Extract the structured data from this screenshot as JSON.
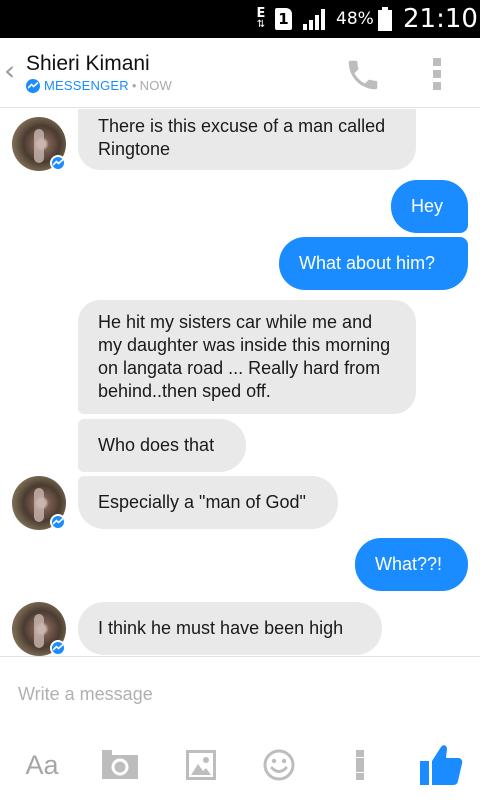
{
  "status_bar": {
    "network_letter": "E",
    "network_arrows": "⇅",
    "sim_label": "1",
    "battery_percent": "48%",
    "time": "21:10"
  },
  "header": {
    "contact_name": "Shieri Kimani",
    "app_name": "MESSENGER",
    "separator": "•",
    "last_active": "NOW",
    "back_glyph": "‹",
    "icons": [
      "back-icon",
      "phone-icon",
      "more-vertical-icon"
    ]
  },
  "messages": [
    {
      "from": "them",
      "text": "There is this excuse of a man called Ringtone"
    },
    {
      "from": "me",
      "text": "Hey"
    },
    {
      "from": "me",
      "text": "What about him?"
    },
    {
      "from": "them",
      "text": "He hit my sisters car while me and my daughter was inside this morning on langata road ... Really hard from behind..then sped off."
    },
    {
      "from": "them",
      "text": "Who does that"
    },
    {
      "from": "them",
      "text": "Especially a \"man of God\""
    },
    {
      "from": "me",
      "text": "What??!"
    },
    {
      "from": "them",
      "text": "I think he must have been high"
    }
  ],
  "composer": {
    "placeholder": "Write a message",
    "value": "",
    "text_format_label": "Aa",
    "icons": [
      "text-format-icon",
      "camera-icon",
      "gallery-icon",
      "emoji-icon",
      "more-vertical-icon",
      "thumbs-up-icon"
    ]
  },
  "colors": {
    "accent": "#1a8cff",
    "incoming_bubble": "#e9e9e9",
    "status_bar": "#000000",
    "icon_gray": "#bdbdbd"
  }
}
